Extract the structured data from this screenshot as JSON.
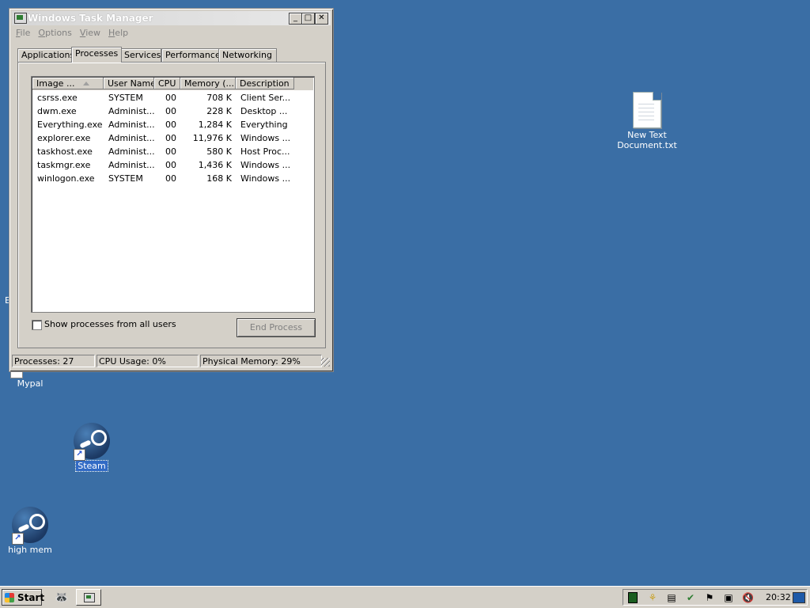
{
  "desktop": {
    "icons": [
      {
        "label": "New Text Document.txt"
      },
      {
        "label": "Mypal"
      },
      {
        "label": "Steam"
      },
      {
        "label": "high mem"
      }
    ],
    "edge_char": "E"
  },
  "window": {
    "title": "Windows Task Manager",
    "controls": {
      "minimize": "_",
      "maximize": "□",
      "close": "✕"
    },
    "menu": [
      "File",
      "Options",
      "View",
      "Help"
    ],
    "tabs": [
      "Applications",
      "Processes",
      "Services",
      "Performance",
      "Networking"
    ],
    "active_tab": "Processes",
    "columns": [
      "Image ...",
      "User Name",
      "CPU",
      "Memory (...",
      "Description"
    ],
    "processes": [
      {
        "image": "csrss.exe",
        "user": "SYSTEM",
        "cpu": "00",
        "memory": "708 K",
        "description": "Client Ser..."
      },
      {
        "image": "dwm.exe",
        "user": "Administ...",
        "cpu": "00",
        "memory": "228 K",
        "description": "Desktop ..."
      },
      {
        "image": "Everything.exe",
        "user": "Administ...",
        "cpu": "00",
        "memory": "1,284 K",
        "description": "Everything"
      },
      {
        "image": "explorer.exe",
        "user": "Administ...",
        "cpu": "00",
        "memory": "11,976 K",
        "description": "Windows ..."
      },
      {
        "image": "taskhost.exe",
        "user": "Administ...",
        "cpu": "00",
        "memory": "580 K",
        "description": "Host Proc..."
      },
      {
        "image": "taskmgr.exe",
        "user": "Administ...",
        "cpu": "00",
        "memory": "1,436 K",
        "description": "Windows ..."
      },
      {
        "image": "winlogon.exe",
        "user": "SYSTEM",
        "cpu": "00",
        "memory": "168 K",
        "description": "Windows ..."
      }
    ],
    "show_all_label": "Show processes from all users",
    "end_process_label": "End Process",
    "status": {
      "processes": "Processes: 27",
      "cpu": "CPU Usage: 0%",
      "memory": "Physical Memory: 29%"
    }
  },
  "taskbar": {
    "start_label": "Start",
    "clock": "20:32"
  },
  "colors": {
    "desktop": "#3a6ea5",
    "chrome": "#d4d0c8",
    "selection": "#316ac5"
  }
}
